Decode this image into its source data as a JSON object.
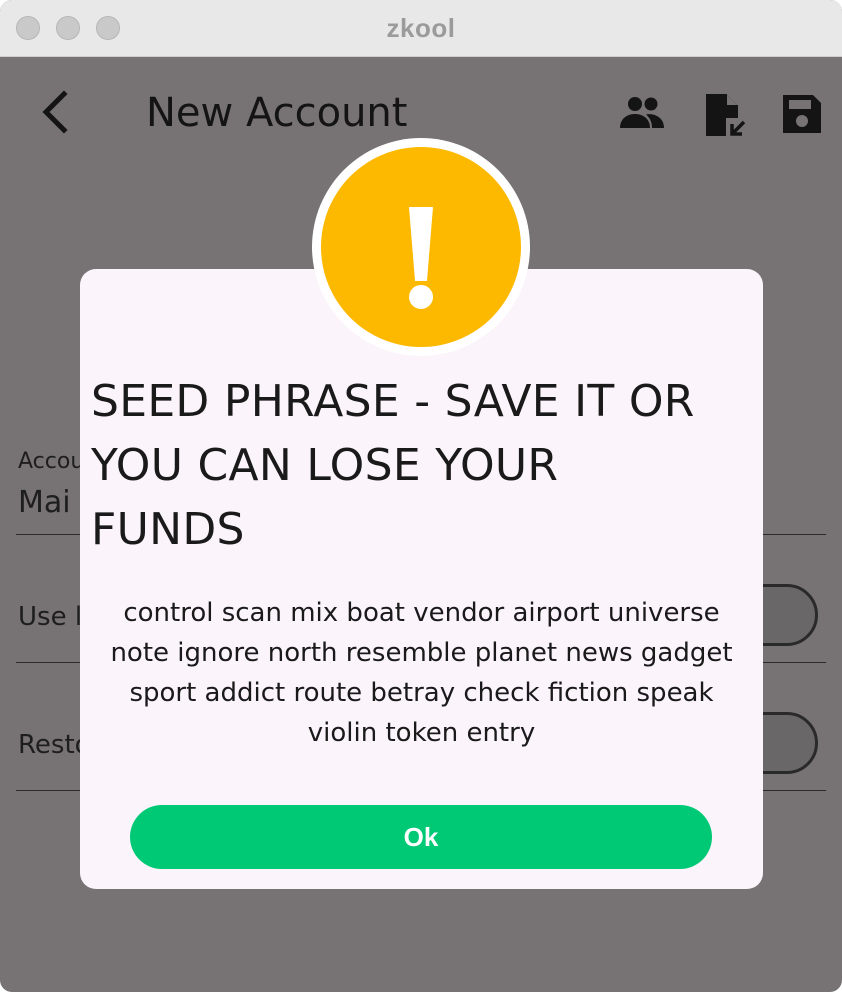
{
  "window": {
    "title": "zkool"
  },
  "appbar": {
    "title": "New Account",
    "icons": [
      "back-arrow-icon",
      "people-icon",
      "file-import-icon",
      "save-icon"
    ]
  },
  "form": {
    "account_label": "Accou",
    "account_value": "Mai",
    "use_row_label": "Use l",
    "restore_row_label": "Resto"
  },
  "dialog": {
    "icon": "warning-icon",
    "accent_color": "#fdb900",
    "title_lines": [
      "SEED PHRASE - SAVE IT OR",
      "YOU CAN LOSE YOUR",
      "FUNDS"
    ],
    "seed_lines": [
      "control scan mix boat vendor airport universe",
      "note ignore north resemble planet news gadget",
      "sport addict route betray check fiction speak",
      "violin token entry"
    ],
    "ok_label": "Ok",
    "ok_color": "#00c975"
  }
}
